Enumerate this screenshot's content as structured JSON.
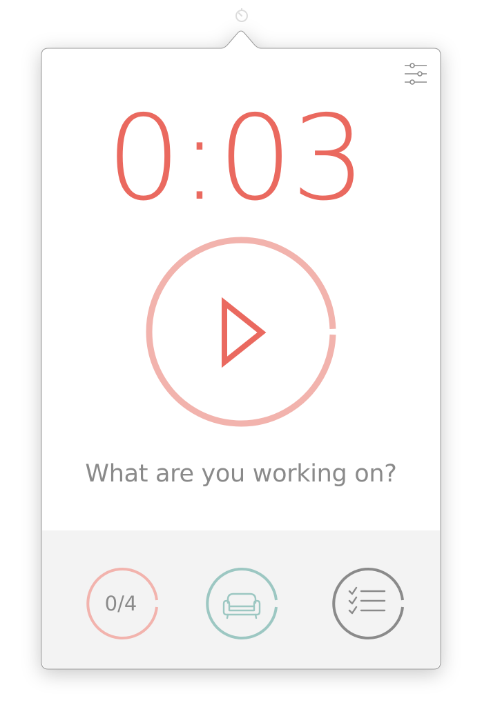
{
  "colors": {
    "accent": "#ea695f",
    "accent_light": "#f2b3ad",
    "teal": "#9cc7c2",
    "gray": "#8a8a8a",
    "footer_bg": "#f3f3f3"
  },
  "menubar": {
    "icon": "timer-icon"
  },
  "timer": {
    "display": "0:03"
  },
  "play_button": {
    "icon": "play-icon",
    "progress": 0.99
  },
  "task": {
    "placeholder": "What are you working on?"
  },
  "footer": {
    "pomodoro_count": "0/4",
    "break_icon": "couch-icon",
    "tasks_icon": "checklist-icon"
  },
  "settings": {
    "icon": "sliders-icon"
  }
}
